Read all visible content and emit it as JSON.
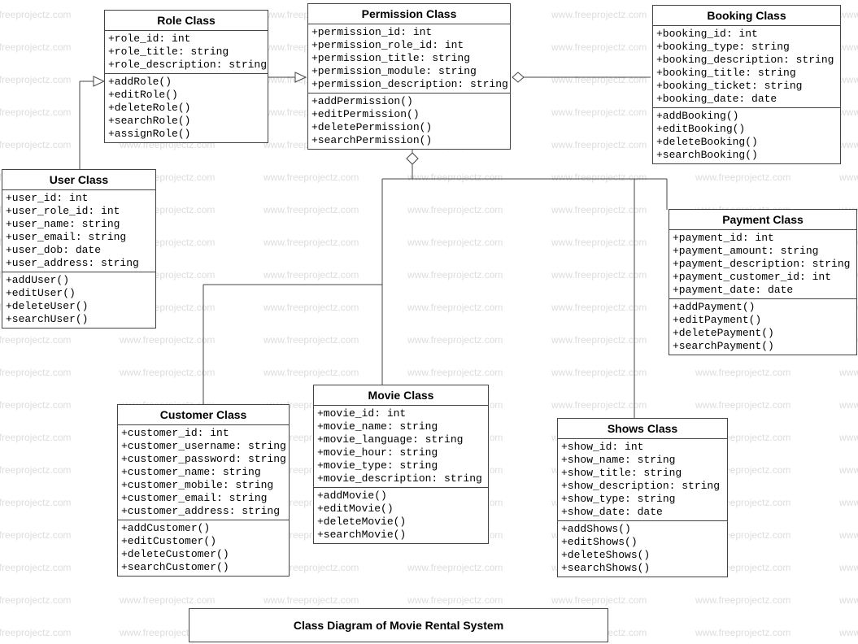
{
  "diagram_title": "Class Diagram of Movie Rental System",
  "watermark_text": "www.freeprojectz.com",
  "classes": {
    "role": {
      "name": "Role Class",
      "attributes": [
        "+role_id: int",
        "+role_title: string",
        "+role_description: string"
      ],
      "methods": [
        "+addRole()",
        "+editRole()",
        "+deleteRole()",
        "+searchRole()",
        "+assignRole()"
      ]
    },
    "permission": {
      "name": "Permission Class",
      "attributes": [
        "+permission_id: int",
        "+permission_role_id: int",
        "+permission_title: string",
        "+permission_module: string",
        "+permission_description: string"
      ],
      "methods": [
        "+addPermission()",
        "+editPermission()",
        "+deletePermission()",
        "+searchPermission()"
      ]
    },
    "booking": {
      "name": "Booking Class",
      "attributes": [
        "+booking_id: int",
        "+booking_type: string",
        "+booking_description: string",
        "+booking_title: string",
        "+booking_ticket: string",
        "+booking_date: date"
      ],
      "methods": [
        "+addBooking()",
        "+editBooking()",
        "+deleteBooking()",
        "+searchBooking()"
      ]
    },
    "user": {
      "name": "User Class",
      "attributes": [
        "+user_id: int",
        "+user_role_id: int",
        "+user_name: string",
        "+user_email: string",
        "+user_dob: date",
        "+user_address: string"
      ],
      "methods": [
        "+addUser()",
        "+editUser()",
        "+deleteUser()",
        "+searchUser()"
      ]
    },
    "payment": {
      "name": "Payment Class",
      "attributes": [
        "+payment_id: int",
        "+payment_amount: string",
        "+payment_description: string",
        "+payment_customer_id: int",
        "+payment_date: date"
      ],
      "methods": [
        "+addPayment()",
        "+editPayment()",
        "+deletePayment()",
        "+searchPayment()"
      ]
    },
    "customer": {
      "name": "Customer Class",
      "attributes": [
        "+customer_id: int",
        "+customer_username: string",
        "+customer_password: string",
        "+customer_name: string",
        "+customer_mobile: string",
        "+customer_email: string",
        "+customer_address: string"
      ],
      "methods": [
        "+addCustomer()",
        "+editCustomer()",
        "+deleteCustomer()",
        "+searchCustomer()"
      ]
    },
    "movie": {
      "name": "Movie  Class",
      "attributes": [
        "+movie_id: int",
        "+movie_name: string",
        "+movie_language: string",
        "+movie_hour: string",
        "+movie_type: string",
        "+movie_description: string"
      ],
      "methods": [
        "+addMovie()",
        "+editMovie()",
        "+deleteMovie()",
        "+searchMovie()"
      ]
    },
    "shows": {
      "name": "Shows Class",
      "attributes": [
        "+show_id: int",
        "+show_name: string",
        "+show_title: string",
        "+show_description: string",
        "+show_type: string",
        "+show_date: date"
      ],
      "methods": [
        "+addShows()",
        "+editShows()",
        "+deleteShows()",
        "+searchShows()"
      ]
    }
  },
  "relationships": [
    {
      "from": "user",
      "to": "role",
      "type": "generalization"
    },
    {
      "from": "role",
      "to": "permission",
      "type": "generalization"
    },
    {
      "from": "permission",
      "to": "booking",
      "type": "aggregation"
    },
    {
      "from": "permission",
      "to": "payment",
      "type": "aggregation"
    },
    {
      "from": "permission",
      "to": "customer",
      "type": "aggregation"
    },
    {
      "from": "permission",
      "to": "movie",
      "type": "aggregation"
    },
    {
      "from": "permission",
      "to": "shows",
      "type": "aggregation"
    }
  ]
}
